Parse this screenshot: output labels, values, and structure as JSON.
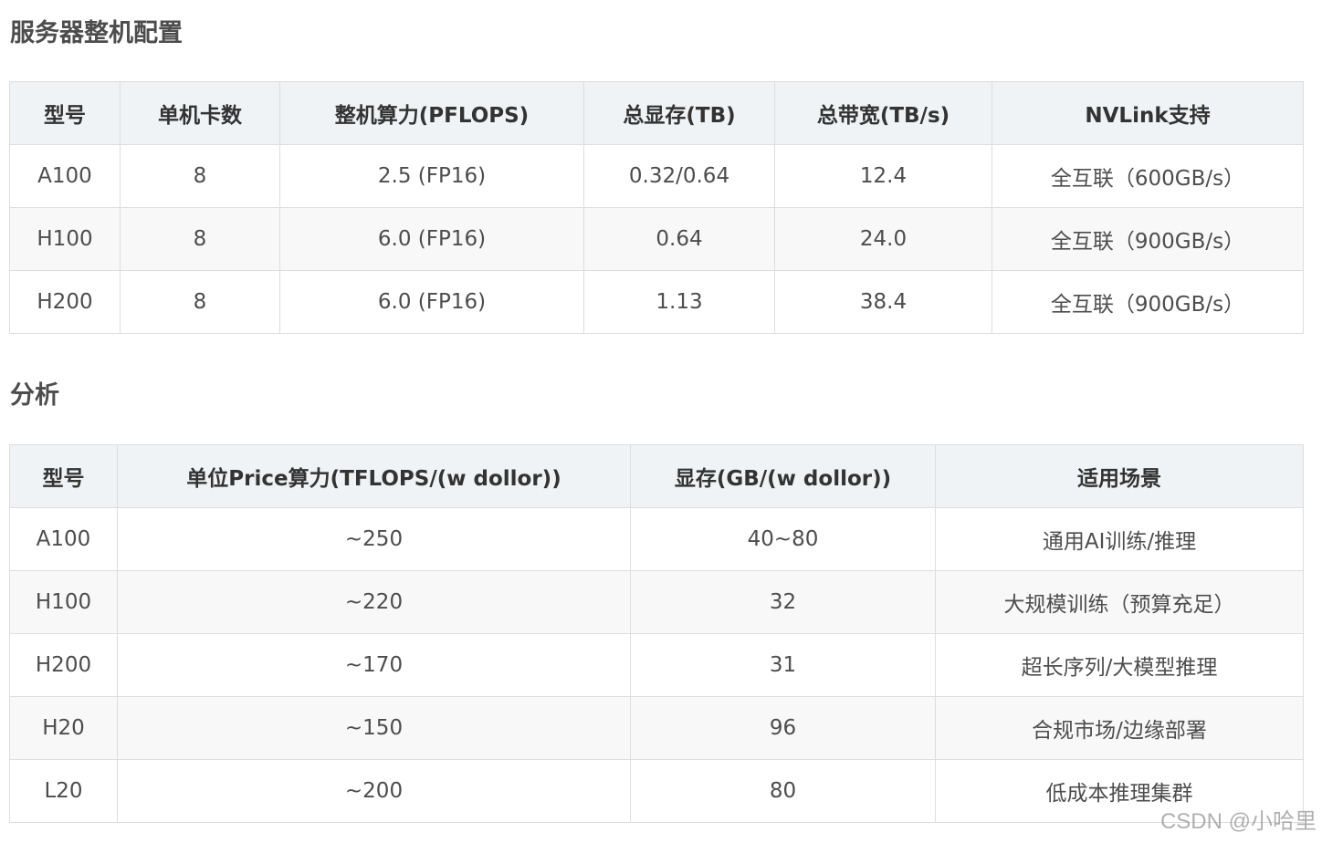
{
  "section1": {
    "title": "服务器整机配置",
    "columns": [
      "型号",
      "单机卡数",
      "整机算力(PFLOPS)",
      "总显存(TB)",
      "总带宽(TB/s)",
      "NVLink支持"
    ],
    "rows": [
      [
        "A100",
        "8",
        "2.5 (FP16)",
        "0.32/0.64",
        "12.4",
        "全互联（600GB/s）"
      ],
      [
        "H100",
        "8",
        "6.0 (FP16)",
        "0.64",
        "24.0",
        "全互联（900GB/s）"
      ],
      [
        "H200",
        "8",
        "6.0 (FP16)",
        "1.13",
        "38.4",
        "全互联（900GB/s）"
      ]
    ]
  },
  "section2": {
    "title": "分析",
    "columns": [
      "型号",
      "单位Price算力(TFLOPS/(w dollor))",
      "显存(GB/(w dollor))",
      "适用场景"
    ],
    "rows": [
      [
        "A100",
        "~250",
        "40~80",
        "通用AI训练/推理"
      ],
      [
        "H100",
        "~220",
        "32",
        "大规模训练（预算充足）"
      ],
      [
        "H200",
        "~170",
        "31",
        "超长序列/大模型推理"
      ],
      [
        "H20",
        "~150",
        "96",
        "合规市场/边缘部署"
      ],
      [
        "L20",
        "~200",
        "80",
        "低成本推理集群"
      ]
    ]
  },
  "watermark": "CSDN @小哈里"
}
